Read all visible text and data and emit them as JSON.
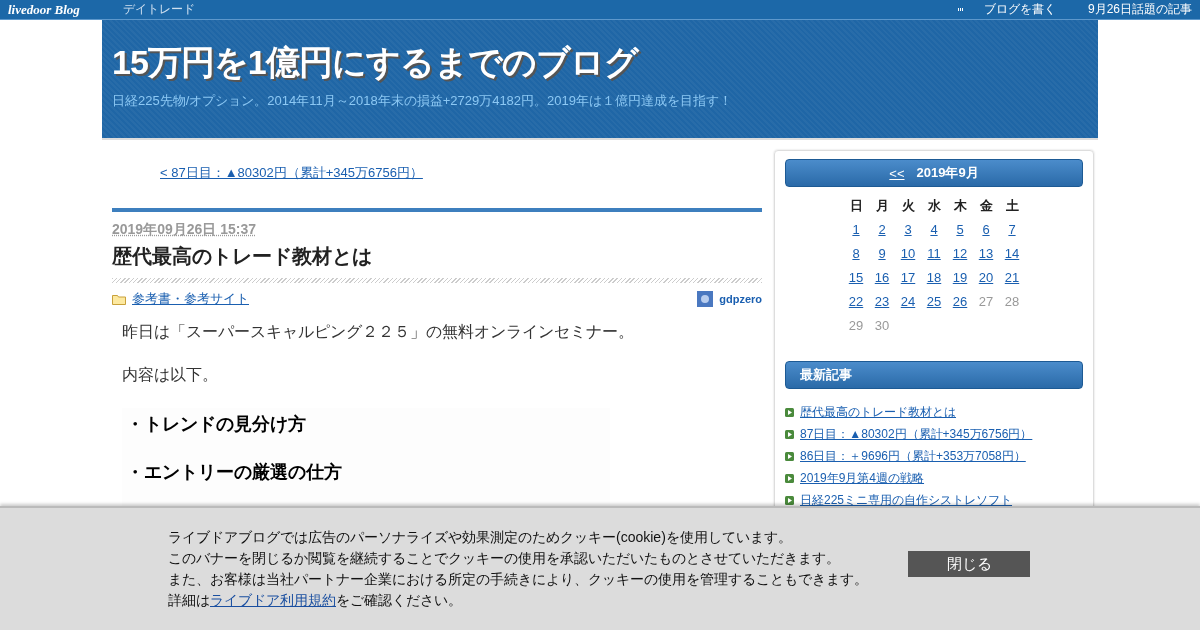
{
  "topbar": {
    "logo": "livedoor Blog",
    "category": "デイトレード",
    "links": [
      "ブログを書く",
      "9月26日話題の記事"
    ]
  },
  "header": {
    "title": "15万円を1億円にするまでのブログ",
    "description": "日経225先物/オプション。2014年11月～2018年末の損益+2729万4182円。2019年は１億円達成を目指す！"
  },
  "prev_link": "< 87日目：▲80302円（累計+345万6756円）",
  "article": {
    "date": "2019年09月26日 15:37",
    "title": "歴代最高のトレード教材とは",
    "category": "参考書・参考サイト",
    "author": "gdpzero",
    "paragraphs": [
      "昨日は「スーパースキャルピング２２５」の無料オンラインセミナー。",
      "内容は以下。"
    ],
    "image_lines": [
      "・トレンドの見分け方",
      "・エントリーの厳選の仕方"
    ]
  },
  "calendar": {
    "prev": "<<",
    "month": "2019年9月",
    "weekdays": [
      "日",
      "月",
      "火",
      "水",
      "木",
      "金",
      "土"
    ],
    "weeks": [
      [
        {
          "day": "1",
          "linked": true
        },
        {
          "day": "2",
          "linked": true
        },
        {
          "day": "3",
          "linked": true
        },
        {
          "day": "4",
          "linked": true
        },
        {
          "day": "5",
          "linked": true
        },
        {
          "day": "6",
          "linked": true
        },
        {
          "day": "7",
          "linked": true
        }
      ],
      [
        {
          "day": "8",
          "linked": true
        },
        {
          "day": "9",
          "linked": true
        },
        {
          "day": "10",
          "linked": true
        },
        {
          "day": "11",
          "linked": true
        },
        {
          "day": "12",
          "linked": true
        },
        {
          "day": "13",
          "linked": true
        },
        {
          "day": "14",
          "linked": true
        }
      ],
      [
        {
          "day": "15",
          "linked": true
        },
        {
          "day": "16",
          "linked": true
        },
        {
          "day": "17",
          "linked": true
        },
        {
          "day": "18",
          "linked": true
        },
        {
          "day": "19",
          "linked": true
        },
        {
          "day": "20",
          "linked": true
        },
        {
          "day": "21",
          "linked": true
        }
      ],
      [
        {
          "day": "22",
          "linked": true
        },
        {
          "day": "23",
          "linked": true
        },
        {
          "day": "24",
          "linked": true
        },
        {
          "day": "25",
          "linked": true
        },
        {
          "day": "26",
          "linked": true
        },
        {
          "day": "27",
          "linked": false
        },
        {
          "day": "28",
          "linked": false
        }
      ],
      [
        {
          "day": "29",
          "linked": false
        },
        {
          "day": "30",
          "linked": false
        }
      ]
    ]
  },
  "recent": {
    "title": "最新記事",
    "items": [
      "歴代最高のトレード教材とは",
      "87日目：▲80302円（累計+345万6756円）",
      "86日目：＋9696円（累計+353万7058円）",
      "2019年9月第4週の戦略",
      "日経225ミニ専用の自作シストレソフト"
    ]
  },
  "cookie_banner": {
    "lines": [
      "ライブドアブログでは広告のパーソナライズや効果測定のためクッキー(cookie)を使用しています。",
      "このバナーを閉じるか閲覧を継続することでクッキーの使用を承認いただいたものとさせていただきます。",
      "また、お客様は当社パートナー企業における所定の手続きにより、クッキーの使用を管理することもできます。"
    ],
    "detail_prefix": "詳細は",
    "detail_link": "ライブドア利用規約",
    "detail_suffix": "をご確認ください。",
    "close": "閉じる"
  }
}
